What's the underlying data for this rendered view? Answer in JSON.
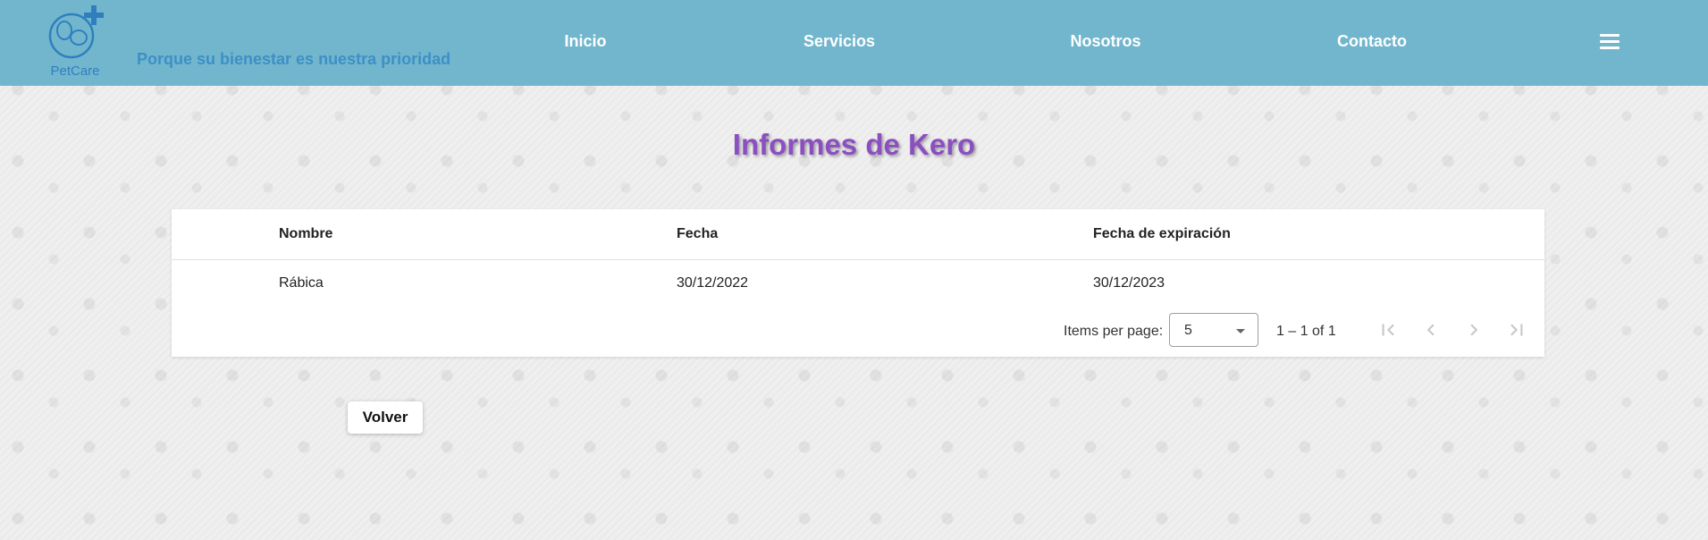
{
  "header": {
    "logo_text": "PetCare",
    "slogan": "Porque su bienestar es nuestra prioridad",
    "nav": [
      "Inicio",
      "Servicios",
      "Nosotros",
      "Contacto"
    ],
    "menu_icon": "hamburger-menu-icon"
  },
  "page": {
    "title": "Informes de Kero"
  },
  "table": {
    "columns": [
      "Nombre",
      "Fecha",
      "Fecha de expiración"
    ],
    "rows": [
      [
        "Rábica",
        "30/12/2022",
        "30/12/2023"
      ]
    ]
  },
  "paginator": {
    "items_per_page_label": "Items per page:",
    "page_size": "5",
    "range": "1 – 1 of 1",
    "icons": [
      "first-page-icon",
      "previous-page-icon",
      "next-page-icon",
      "last-page-icon"
    ]
  },
  "actions": {
    "back_label": "Volver"
  },
  "colors": {
    "navbar": "#72b6cd",
    "slogan": "#3d8fc7",
    "title": "#8c4fc1"
  }
}
